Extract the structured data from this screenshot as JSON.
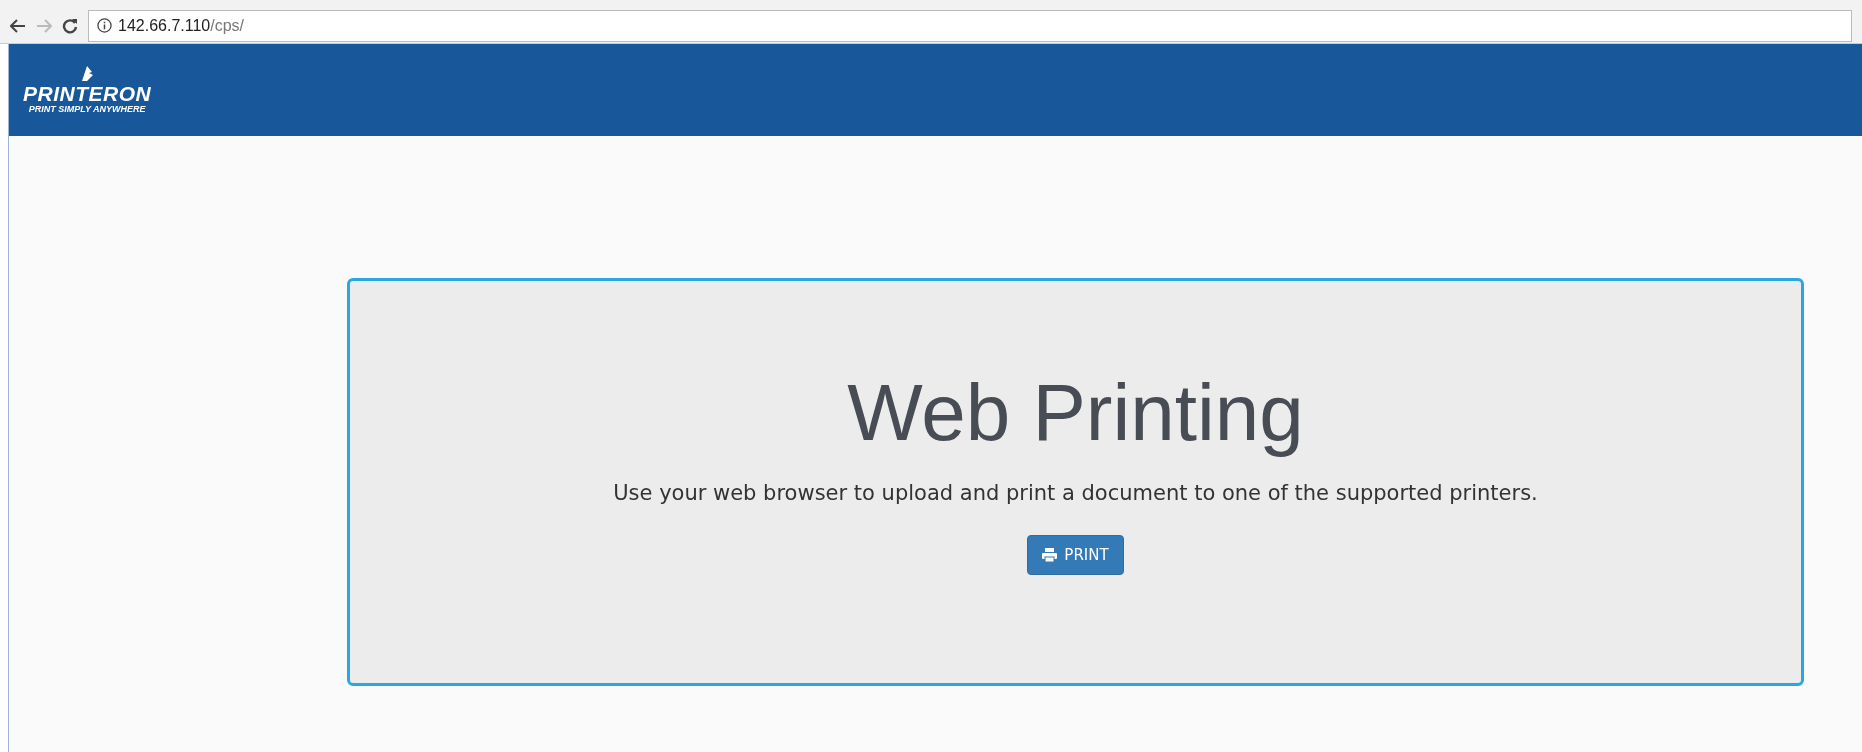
{
  "browser": {
    "url_host": "142.66.7.110",
    "url_path": "/cps/"
  },
  "header": {
    "logo_name": "PRINTERON",
    "logo_tagline": "PRINT SIMPLY ANYWHERE"
  },
  "hero": {
    "title": "Web Printing",
    "description": "Use your web browser to upload and print a document to one of the supported printers.",
    "button": "PRINT"
  }
}
